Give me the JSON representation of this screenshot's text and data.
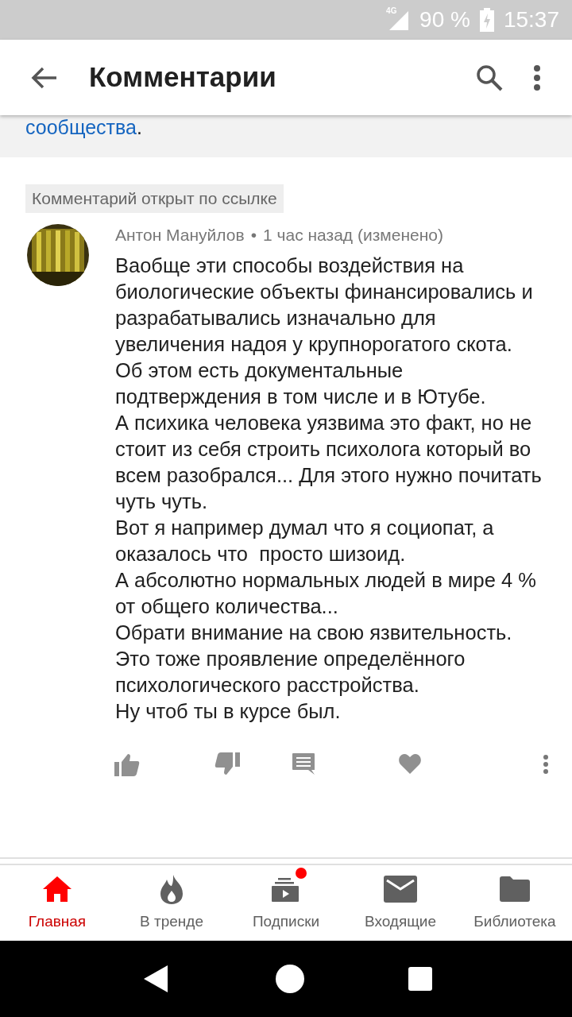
{
  "status_bar": {
    "network": "4G",
    "battery": "90 %",
    "time": "15:37"
  },
  "app_bar": {
    "title": "Комментарии"
  },
  "notice": {
    "link": "сообщества",
    "tail": "."
  },
  "comment": {
    "highlight": "Комментарий открыт по ссылке",
    "author": "Антон Мануйлов",
    "separator": "•",
    "time": "1 час назад (изменено)",
    "paragraphs": [
      "Ваобще эти способы воздействия на биологические объекты финансировались и разрабатывались изначально для увеличения надоя у крупнорогатого скота.",
      "Об этом есть документальные подтверждения в том числе и в Ютубе.",
      "А психика человека уязвима это факт, но не стоит из себя строить психолога который во всем разобрался... Для этого нужно почитать чуть чуть.",
      "Вот я например думал что я социопат, а оказалось что  просто шизоид.",
      "А абсолютно нормальных людей в мире 4 % от общего количества...",
      "Обрати внимание на свою язвительность. Это тоже проявление определённого психологического расстройства.",
      "Ну чтоб ты в курсе был."
    ]
  },
  "bottom_nav": [
    {
      "kind": "home",
      "label": "Главная",
      "selected": true,
      "badge": false
    },
    {
      "kind": "trending",
      "label": "В тренде",
      "selected": false,
      "badge": false
    },
    {
      "kind": "subscriptions",
      "label": "Подписки",
      "selected": false,
      "badge": true
    },
    {
      "kind": "inbox",
      "label": "Входящие",
      "selected": false,
      "badge": false
    },
    {
      "kind": "library",
      "label": "Библиотека",
      "selected": false,
      "badge": false
    }
  ]
}
